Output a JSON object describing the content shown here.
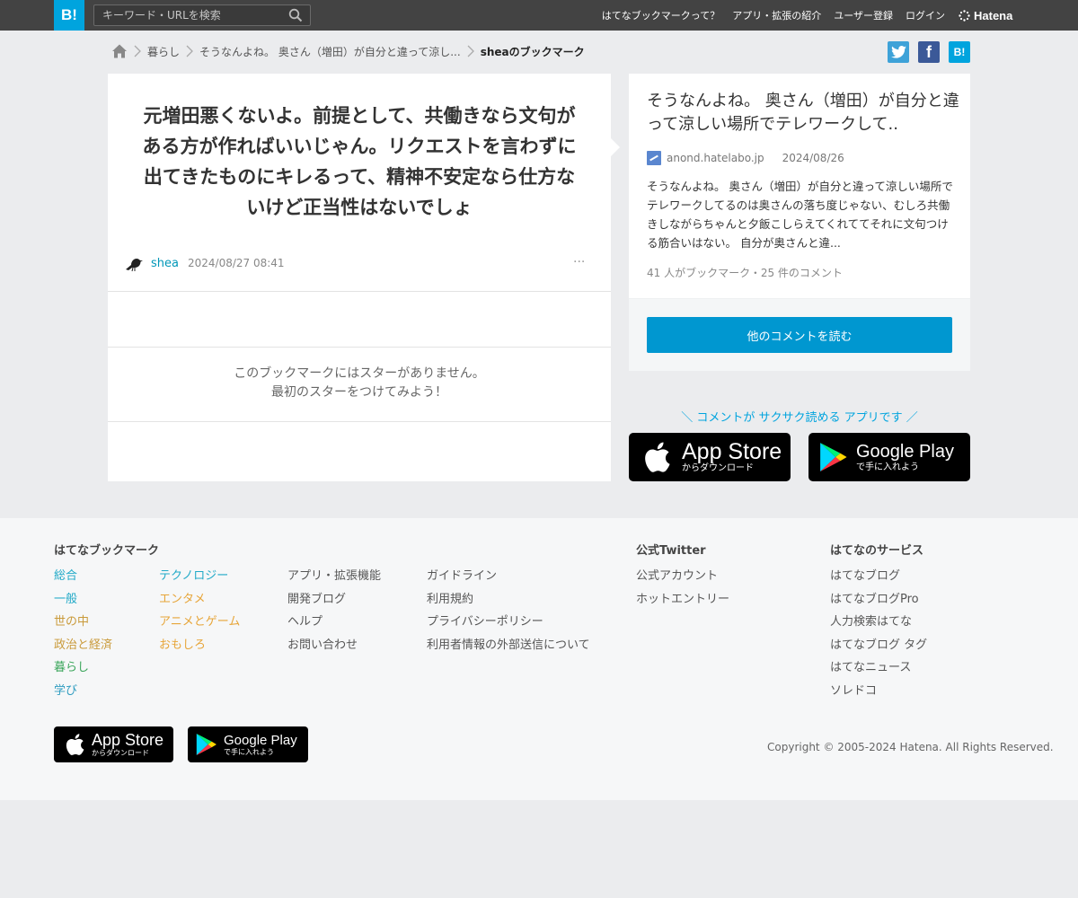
{
  "header": {
    "logo": "B!",
    "search_placeholder": "キーワード・URLを検索",
    "nav": [
      "はてなブックマークって？",
      "アプリ・拡張の紹介",
      "ユーザー登録",
      "ログイン"
    ],
    "brand": "Hatena"
  },
  "breadcrumb": {
    "category": "暮らし",
    "entry": "そうなんよね。 奥さん（増田）が自分と違って涼し...",
    "current": "sheaのブックマーク"
  },
  "share": {
    "twitter": "t",
    "facebook": "f",
    "hatena": "B!"
  },
  "bookmark": {
    "comment": "元増田悪くないよ。前提として、共働きなら文句がある方が作ればいいじゃん。リクエストを言わずに出てきたものにキレるって、精神不安定なら仕方ないけど正当性はないでしょ",
    "user": "shea",
    "datetime": "2024/08/27 08:41",
    "more": "···",
    "no_star_line1": "このブックマークにはスターがありません。",
    "no_star_line2": "最初のスターをつけてみよう！"
  },
  "entry": {
    "title": "そうなんよね。 奥さん（増田）が自分と違って涼しい場所でテレワークして..",
    "domain": "anond.hatelabo.jp",
    "date": "2024/08/26",
    "summary": "そうなんよね。 奥さん（増田）が自分と違って涼しい場所でテレワークしてるのは奥さんの落ち度じゃない、むしろ共働きしながらちゃんと夕飯こしらえてくれててそれに文句つける筋合いはない。 自分が奥さんと違...",
    "stats": "41 人がブックマーク・25 件のコメント",
    "read_button": "他のコメントを読む"
  },
  "promo": {
    "text": "＼ コメントが サクサク読める アプリです ／",
    "appstore_title": "App Store",
    "appstore_sub": "からダウンロード",
    "googleplay_title": "Google Play",
    "googleplay_sub": "で手に入れよう"
  },
  "footer": {
    "bookmark_heading": "はてなブックマーク",
    "categories_col1": [
      "総合",
      "一般",
      "世の中",
      "政治と経済",
      "暮らし",
      "学び"
    ],
    "categories_col2": [
      "テクノロジー",
      "エンタメ",
      "アニメとゲーム",
      "おもしろ"
    ],
    "links_col3": [
      "アプリ・拡張機能",
      "開発ブログ",
      "ヘルプ",
      "お問い合わせ"
    ],
    "links_col4": [
      "ガイドライン",
      "利用規約",
      "プライバシーポリシー",
      "利用者情報の外部送信について"
    ],
    "twitter_heading": "公式Twitter",
    "twitter_links": [
      "公式アカウント",
      "ホットエントリー"
    ],
    "services_heading": "はてなのサービス",
    "services": [
      "はてなブログ",
      "はてなブログPro",
      "人力検索はてな",
      "はてなブログ タグ",
      "はてなニュース",
      "ソレドコ"
    ],
    "appstore_title": "App Store",
    "appstore_sub": "からダウンロード",
    "googleplay_title": "Google Play",
    "googleplay_sub": "で手に入れよう",
    "copyright": "Copyright © 2005-2024 Hatena. All Rights Reserved."
  },
  "colors": {
    "brand_blue": "#00a4de",
    "header_bg": "#434343",
    "button_blue": "#0097d0",
    "link_teal": "#20a9c7",
    "category_green": "#3aa55a",
    "category_orange": "#e7a539"
  }
}
